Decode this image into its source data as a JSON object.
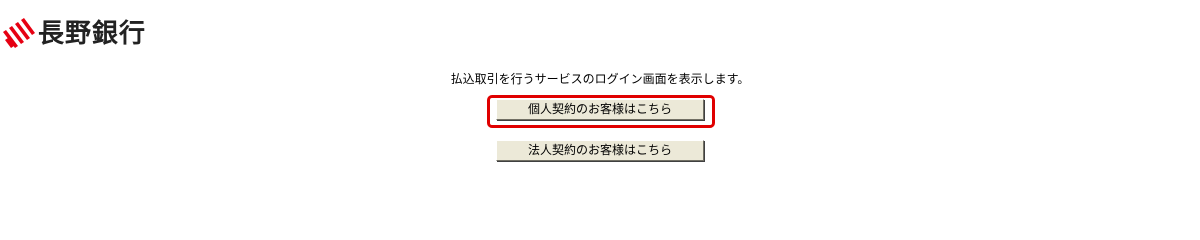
{
  "header": {
    "bank_name": "長野銀行",
    "logo_icon": "bank-logo-icon",
    "logo_color": "#e60012"
  },
  "main": {
    "description": "払込取引を行うサービスのログイン画面を表示します。",
    "personal_button_label": "個人契約のお客様はこちら",
    "corporate_button_label": "法人契約のお客様はこちら",
    "highlight_color": "#e00000"
  }
}
